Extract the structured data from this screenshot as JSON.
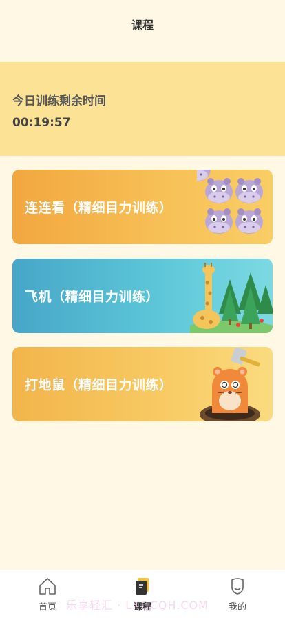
{
  "header": {
    "title": "课程"
  },
  "timer": {
    "label": "今日训练剩余时间",
    "value": "00:19:57"
  },
  "courses": [
    {
      "label": "连连看（精细目力训练）",
      "icon": "hippo-faces-icon"
    },
    {
      "label": "飞机（精细目力训练）",
      "icon": "giraffe-forest-icon"
    },
    {
      "label": "打地鼠（精细目力训练）",
      "icon": "hamster-hammer-icon"
    }
  ],
  "tabs": [
    {
      "label": "首页",
      "icon": "home-icon",
      "active": false
    },
    {
      "label": "课程",
      "icon": "course-icon",
      "active": true
    },
    {
      "label": "我的",
      "icon": "profile-icon",
      "active": false
    }
  ],
  "watermark": "乐享轻汇 · LXQCQH.COM",
  "colors": {
    "background": "#FFF8E5",
    "timer_panel": "#FBE294",
    "card_orange": "#F2A73F",
    "card_blue": "#47A6C8",
    "card_yellow": "#F2B54B"
  }
}
